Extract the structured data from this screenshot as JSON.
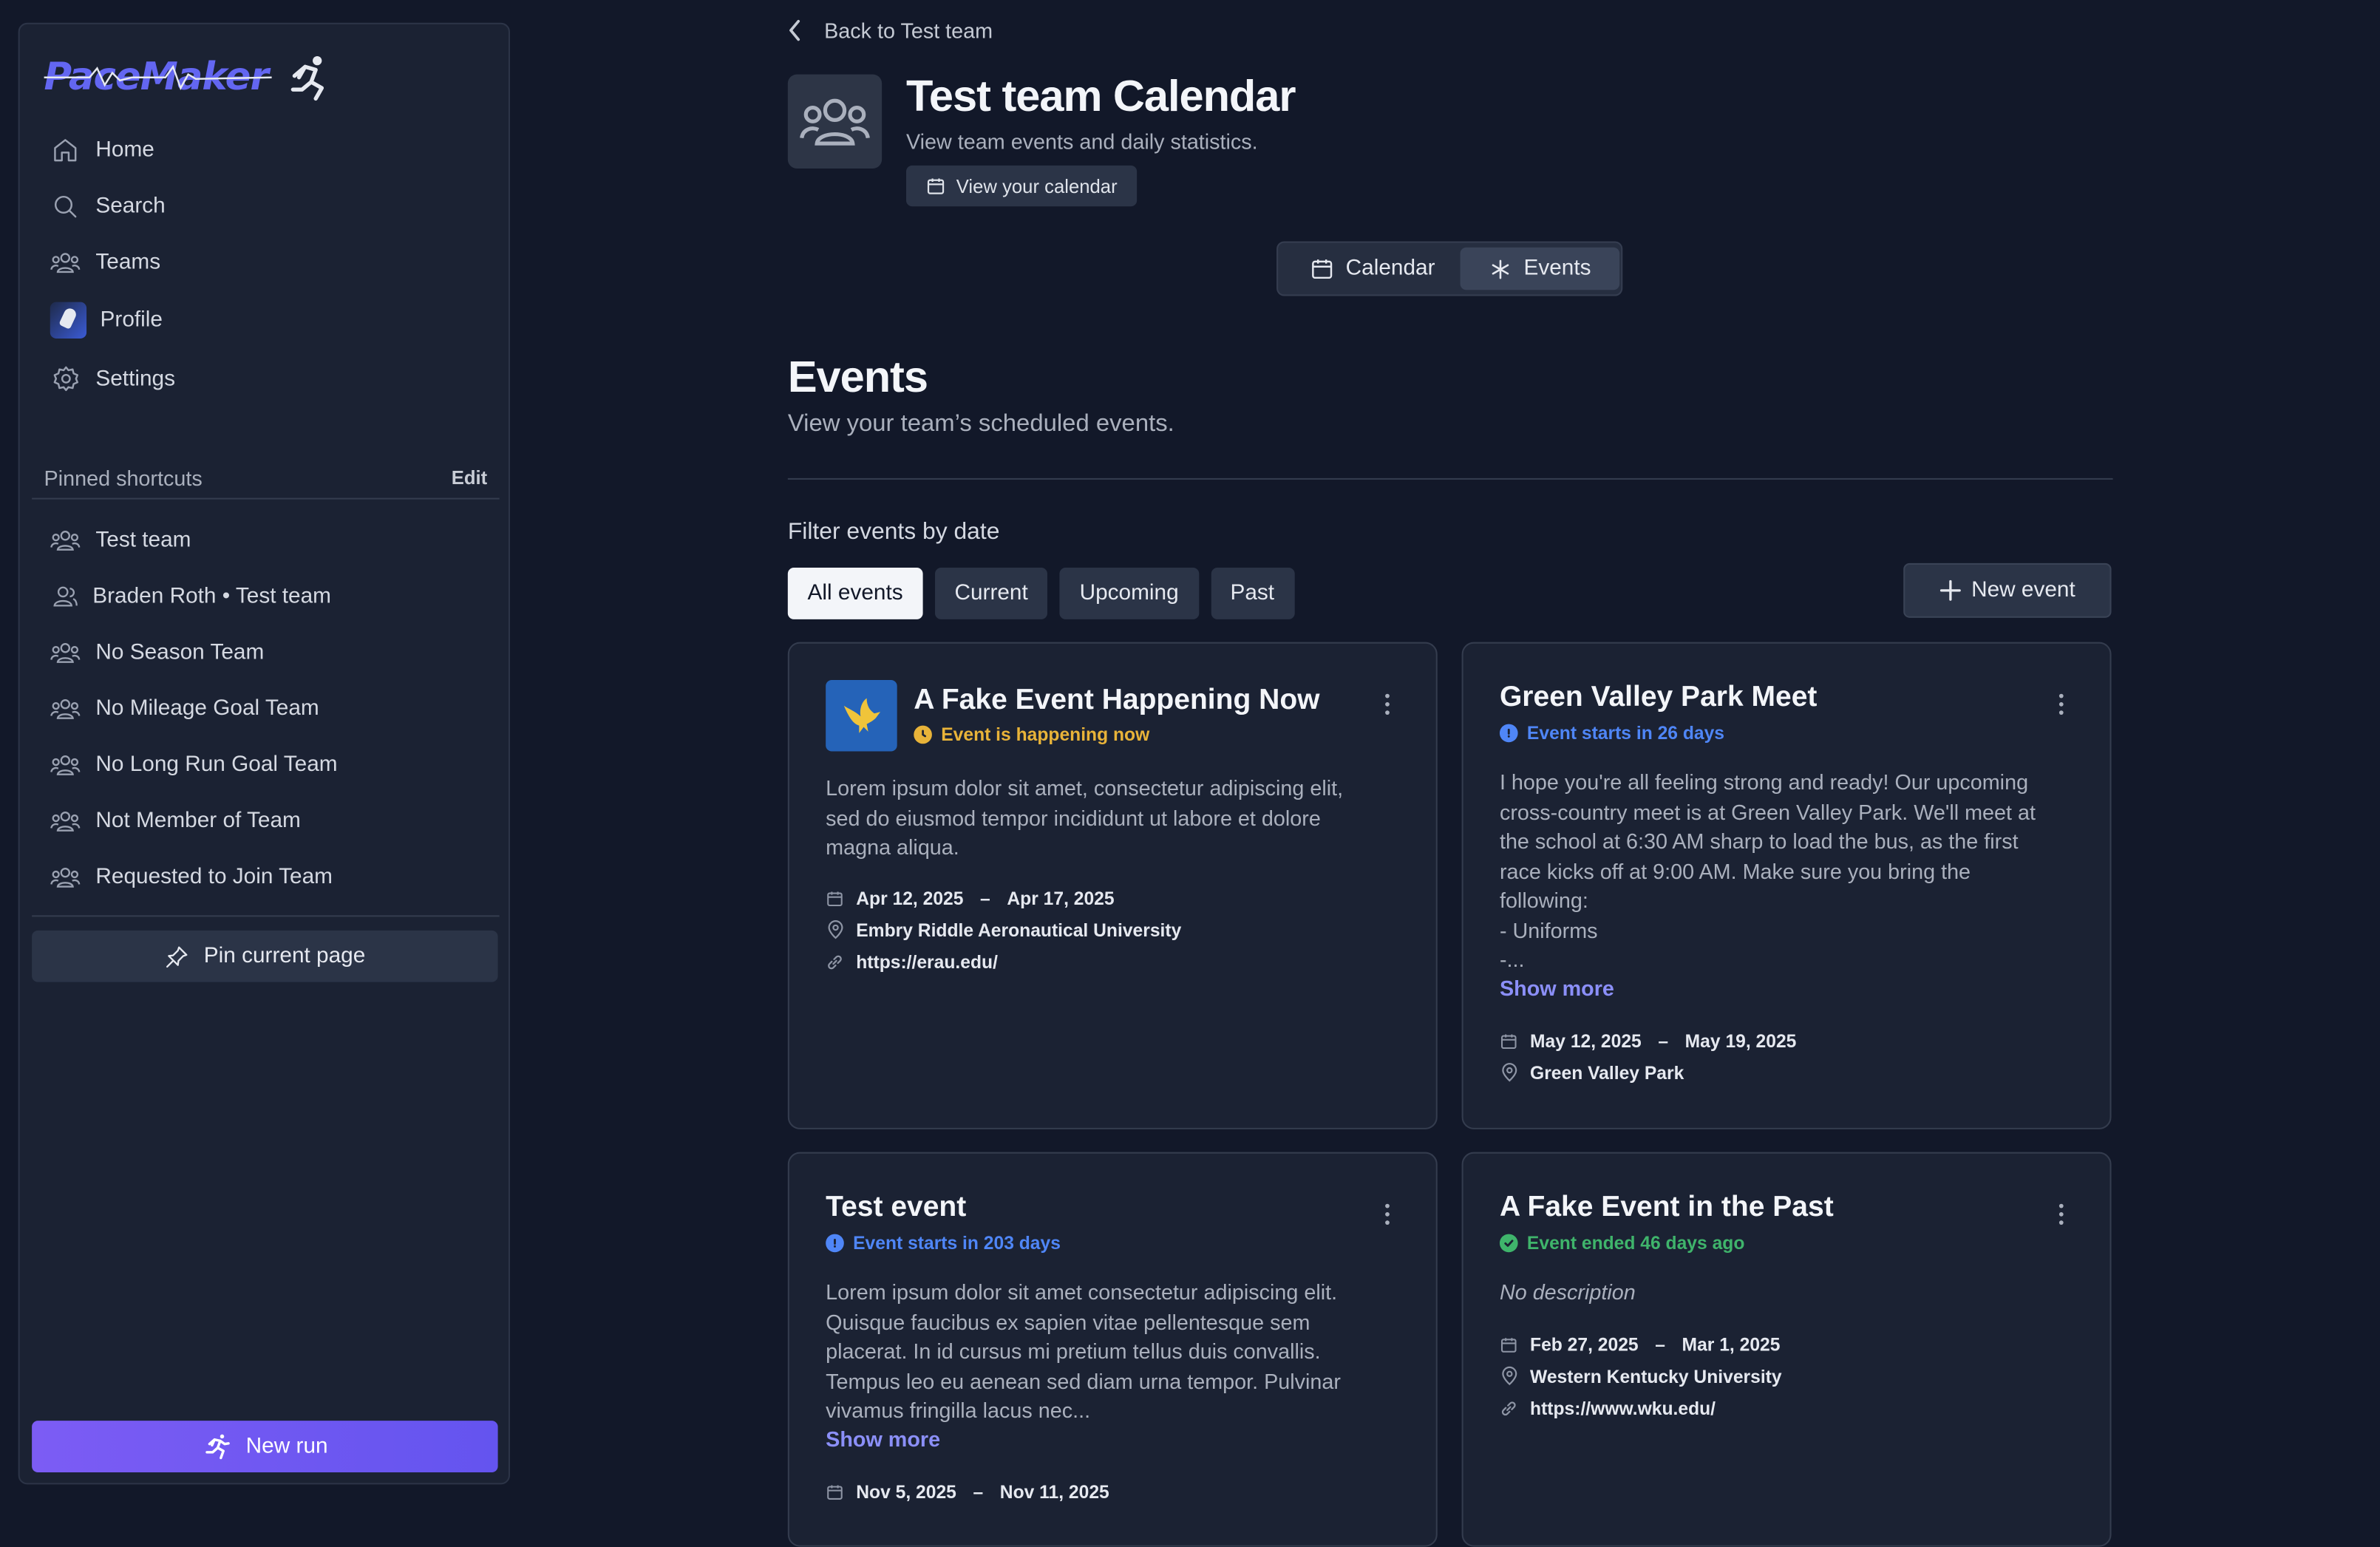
{
  "app": {
    "logo_text": "PaceMaker"
  },
  "sidebar": {
    "nav": [
      {
        "label": "Home",
        "icon": "home-icon"
      },
      {
        "label": "Search",
        "icon": "search-icon"
      },
      {
        "label": "Teams",
        "icon": "users-icon"
      },
      {
        "label": "Profile",
        "icon": "avatar"
      },
      {
        "label": "Settings",
        "icon": "gear-icon"
      }
    ],
    "pinned_label": "Pinned shortcuts",
    "edit_label": "Edit",
    "shortcuts": [
      {
        "label": "Test team"
      },
      {
        "label": "Braden Roth • Test team"
      },
      {
        "label": "No Season Team"
      },
      {
        "label": "No Mileage Goal Team"
      },
      {
        "label": "No Long Run Goal Team"
      },
      {
        "label": "Not Member of Team"
      },
      {
        "label": "Requested to Join Team"
      }
    ],
    "pin_button": "Pin current page",
    "run_button": "New run"
  },
  "header": {
    "back_label": "Back to Test team",
    "title": "Test team Calendar",
    "subtitle": "View team events and daily statistics.",
    "view_calendar": "View your calendar"
  },
  "tabs": {
    "calendar": "Calendar",
    "events": "Events",
    "active": "Events"
  },
  "events_section": {
    "title": "Events",
    "subtitle": "View your team’s scheduled events.",
    "filter_label": "Filter events by date",
    "filters": [
      "All events",
      "Current",
      "Upcoming",
      "Past"
    ],
    "active_filter": "All events",
    "new_event": "New event"
  },
  "events": [
    {
      "title": "A Fake Event Happening Now",
      "status": "Event is happening now",
      "status_color": "#e8b339",
      "description": "Lorem ipsum dolor sit amet, consectetur adipiscing elit,\nsed do eiusmod tempor incididunt ut labore et dolore\nmagna aliqua.",
      "start": "Apr 12, 2025",
      "end": "Apr 17, 2025",
      "location": "Embry Riddle Aeronautical University",
      "url": "https://erau.edu/"
    },
    {
      "title": "Green Valley Park Meet",
      "status": "Event starts in 26 days",
      "status_color": "#4f86f7",
      "description": "I hope you're all feeling strong and ready! Our upcoming\ncross-country meet is at Green Valley Park. We'll meet at\nthe school at 6:30 AM sharp to load the bus, as the first\nrace kicks off at 9:00 AM. Make sure you bring the\nfollowing:\n- Uniforms\n-...",
      "show_more": "Show more",
      "start": "May 12, 2025",
      "end": "May 19, 2025",
      "location": "Green Valley Park"
    },
    {
      "title": "Test event",
      "status": "Event starts in 203 days",
      "status_color": "#4f86f7",
      "description": "Lorem ipsum dolor sit amet consectetur adipiscing elit.\nQuisque faucibus ex sapien vitae pellentesque sem\nplacerat. In id cursus mi pretium tellus duis convallis.\nTempus leo eu aenean sed diam urna tempor. Pulvinar\nvivamus fringilla lacus nec...",
      "show_more": "Show more",
      "start": "Nov 5, 2025",
      "end": "Nov 11, 2025"
    },
    {
      "title": "A Fake Event in the Past",
      "status": "Event ended 46 days ago",
      "status_color": "#3fb46b",
      "description": "No description",
      "start": "Feb 27, 2025",
      "end": "Mar 1, 2025",
      "location": "Western Kentucky University",
      "url": "https://www.wku.edu/"
    }
  ],
  "date_separator": "–"
}
